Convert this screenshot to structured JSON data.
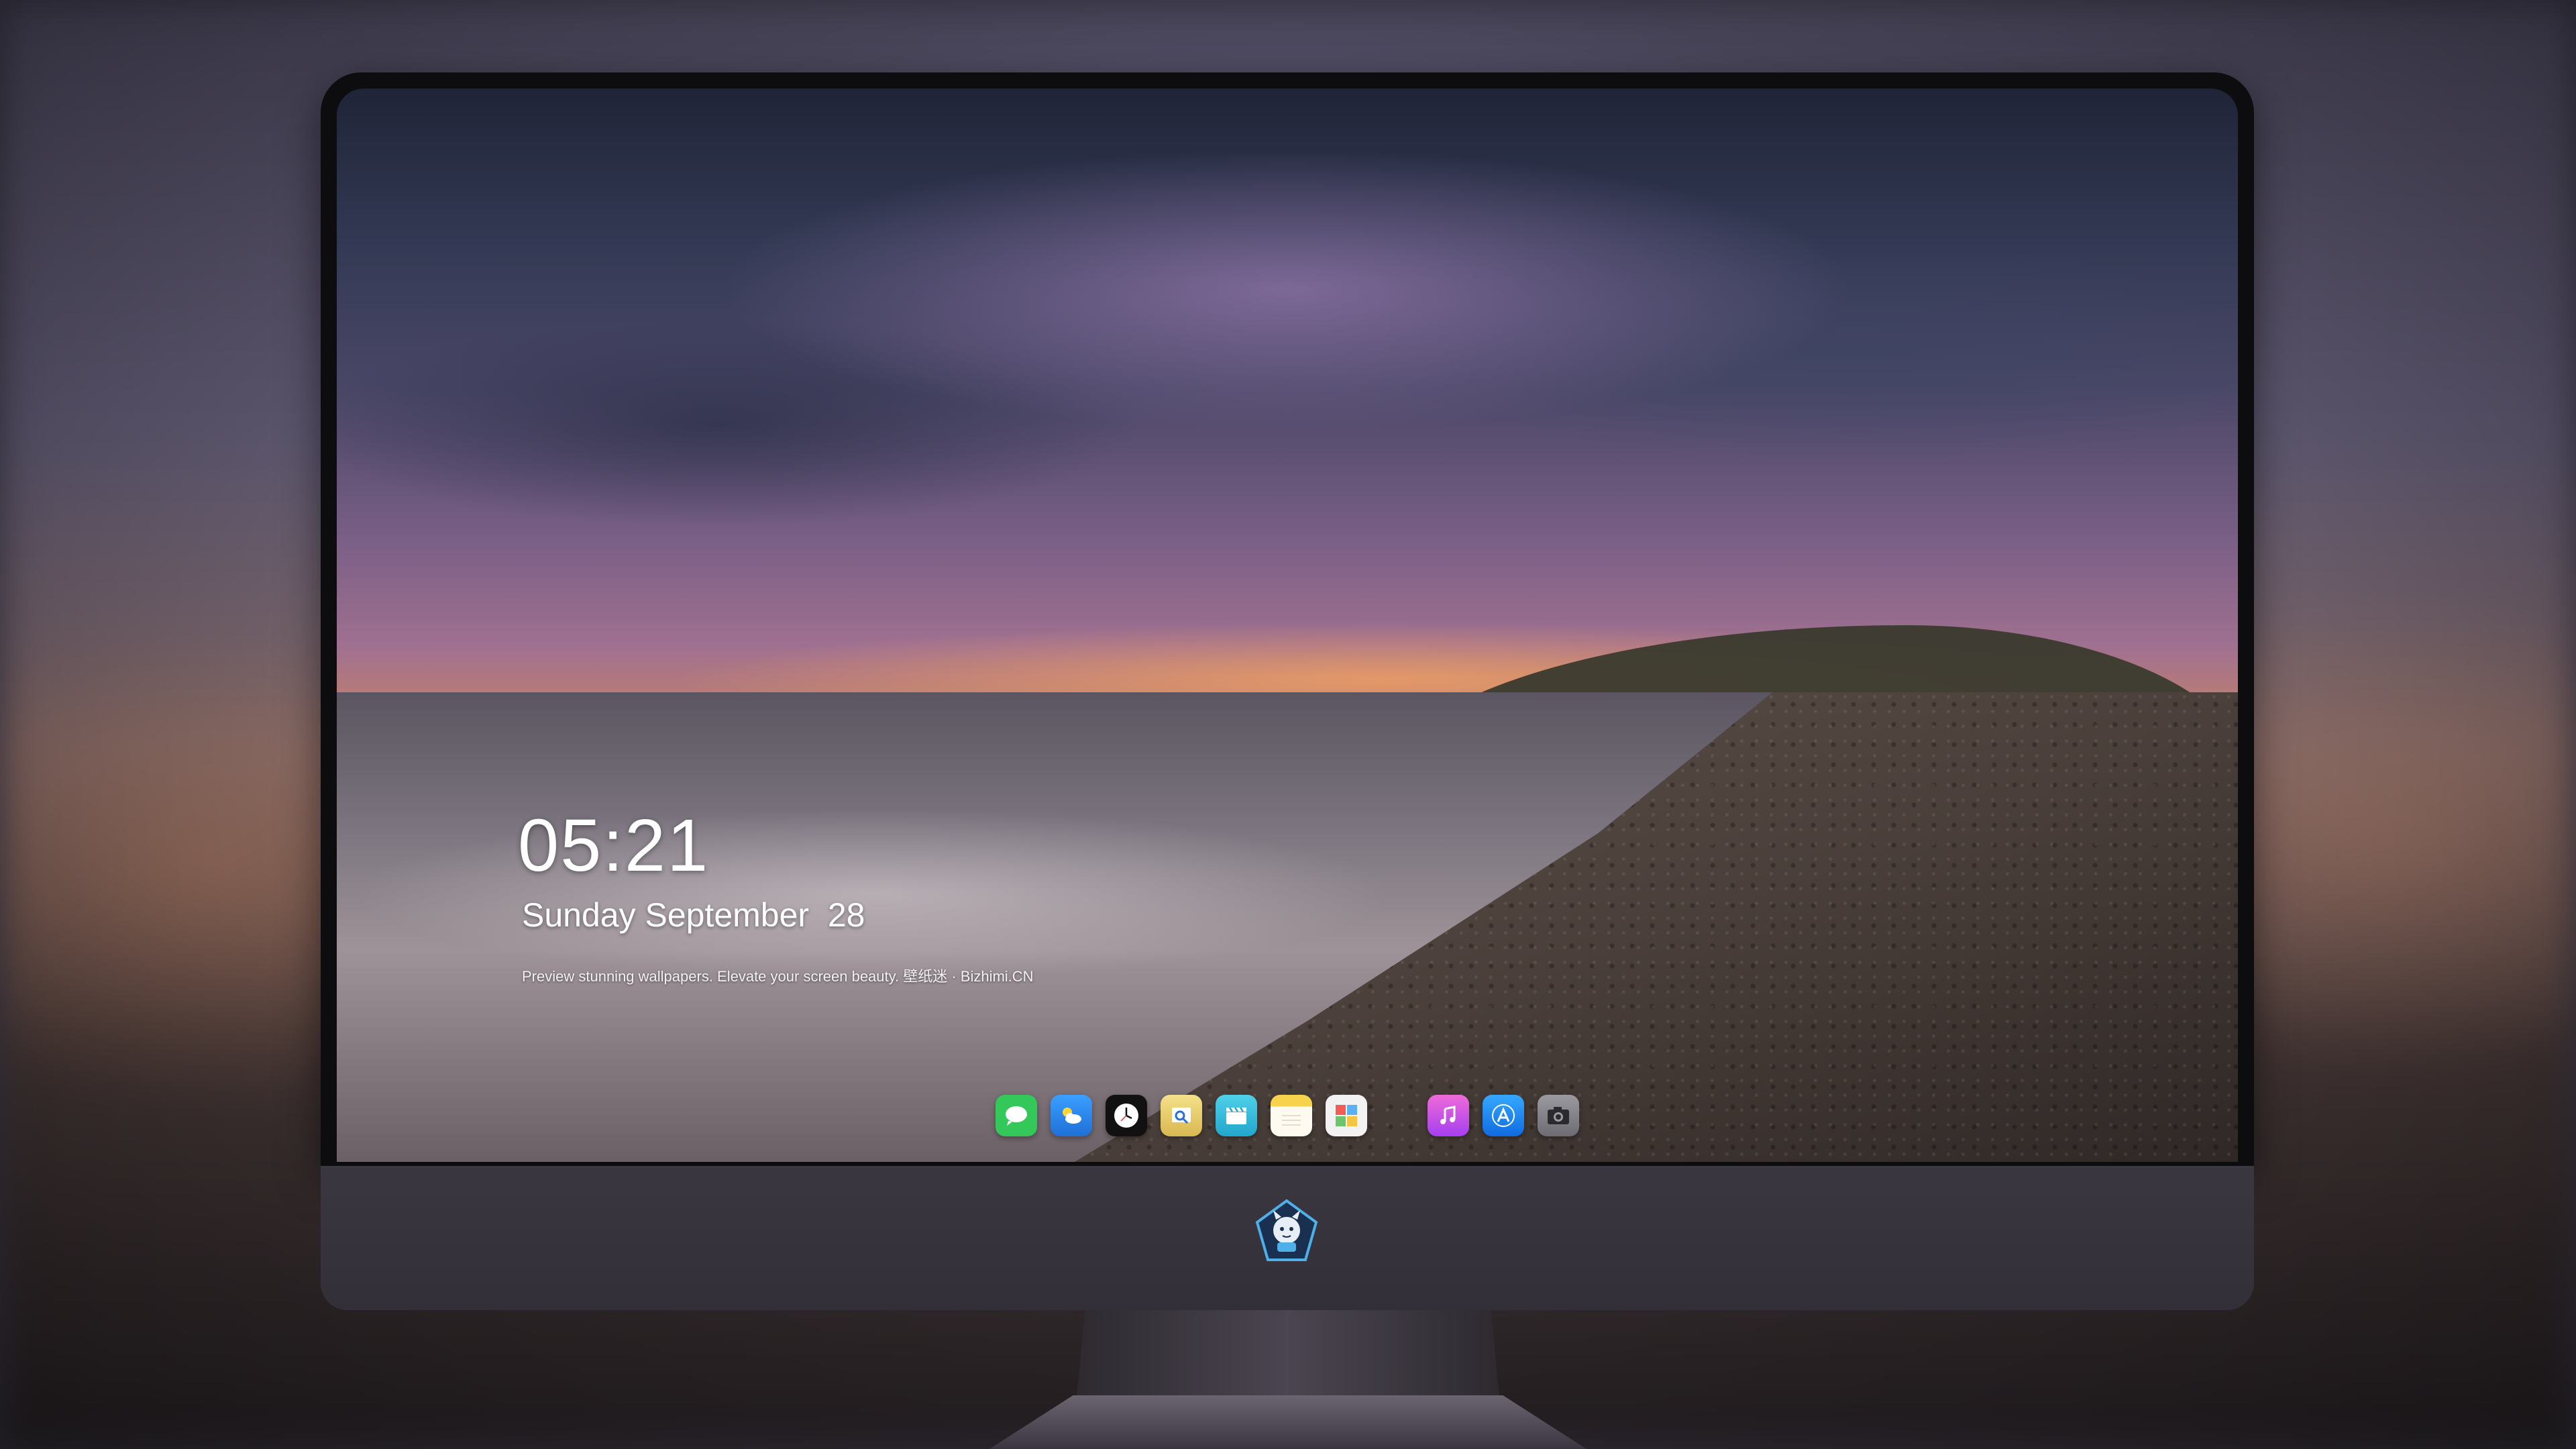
{
  "lockscreen": {
    "time": "05:21",
    "date": "Sunday September  28",
    "tagline": "Preview stunning wallpapers. Elevate your screen beauty. 壁纸迷 · Bizhimi.CN"
  },
  "dock": {
    "apps": [
      {
        "name": "messages-icon",
        "color": "#34c759"
      },
      {
        "name": "weather-icon",
        "color": "#2f8cf0"
      },
      {
        "name": "clock-icon",
        "color": "#111111"
      },
      {
        "name": "preview-icon",
        "color": "#e9d070"
      },
      {
        "name": "clips-icon",
        "color": "#35c2e0"
      },
      {
        "name": "notes-icon",
        "color": "#f7d24a"
      },
      {
        "name": "photo-booth-icon",
        "color": "#f0f0f0"
      },
      {
        "name": "itunes-icon",
        "color": "#d94ef0"
      },
      {
        "name": "app-store-icon",
        "color": "#1e90ff"
      },
      {
        "name": "camera-icon",
        "color": "#8e8e93"
      }
    ]
  },
  "monitor": {
    "logo": "mascot-logo-icon"
  }
}
